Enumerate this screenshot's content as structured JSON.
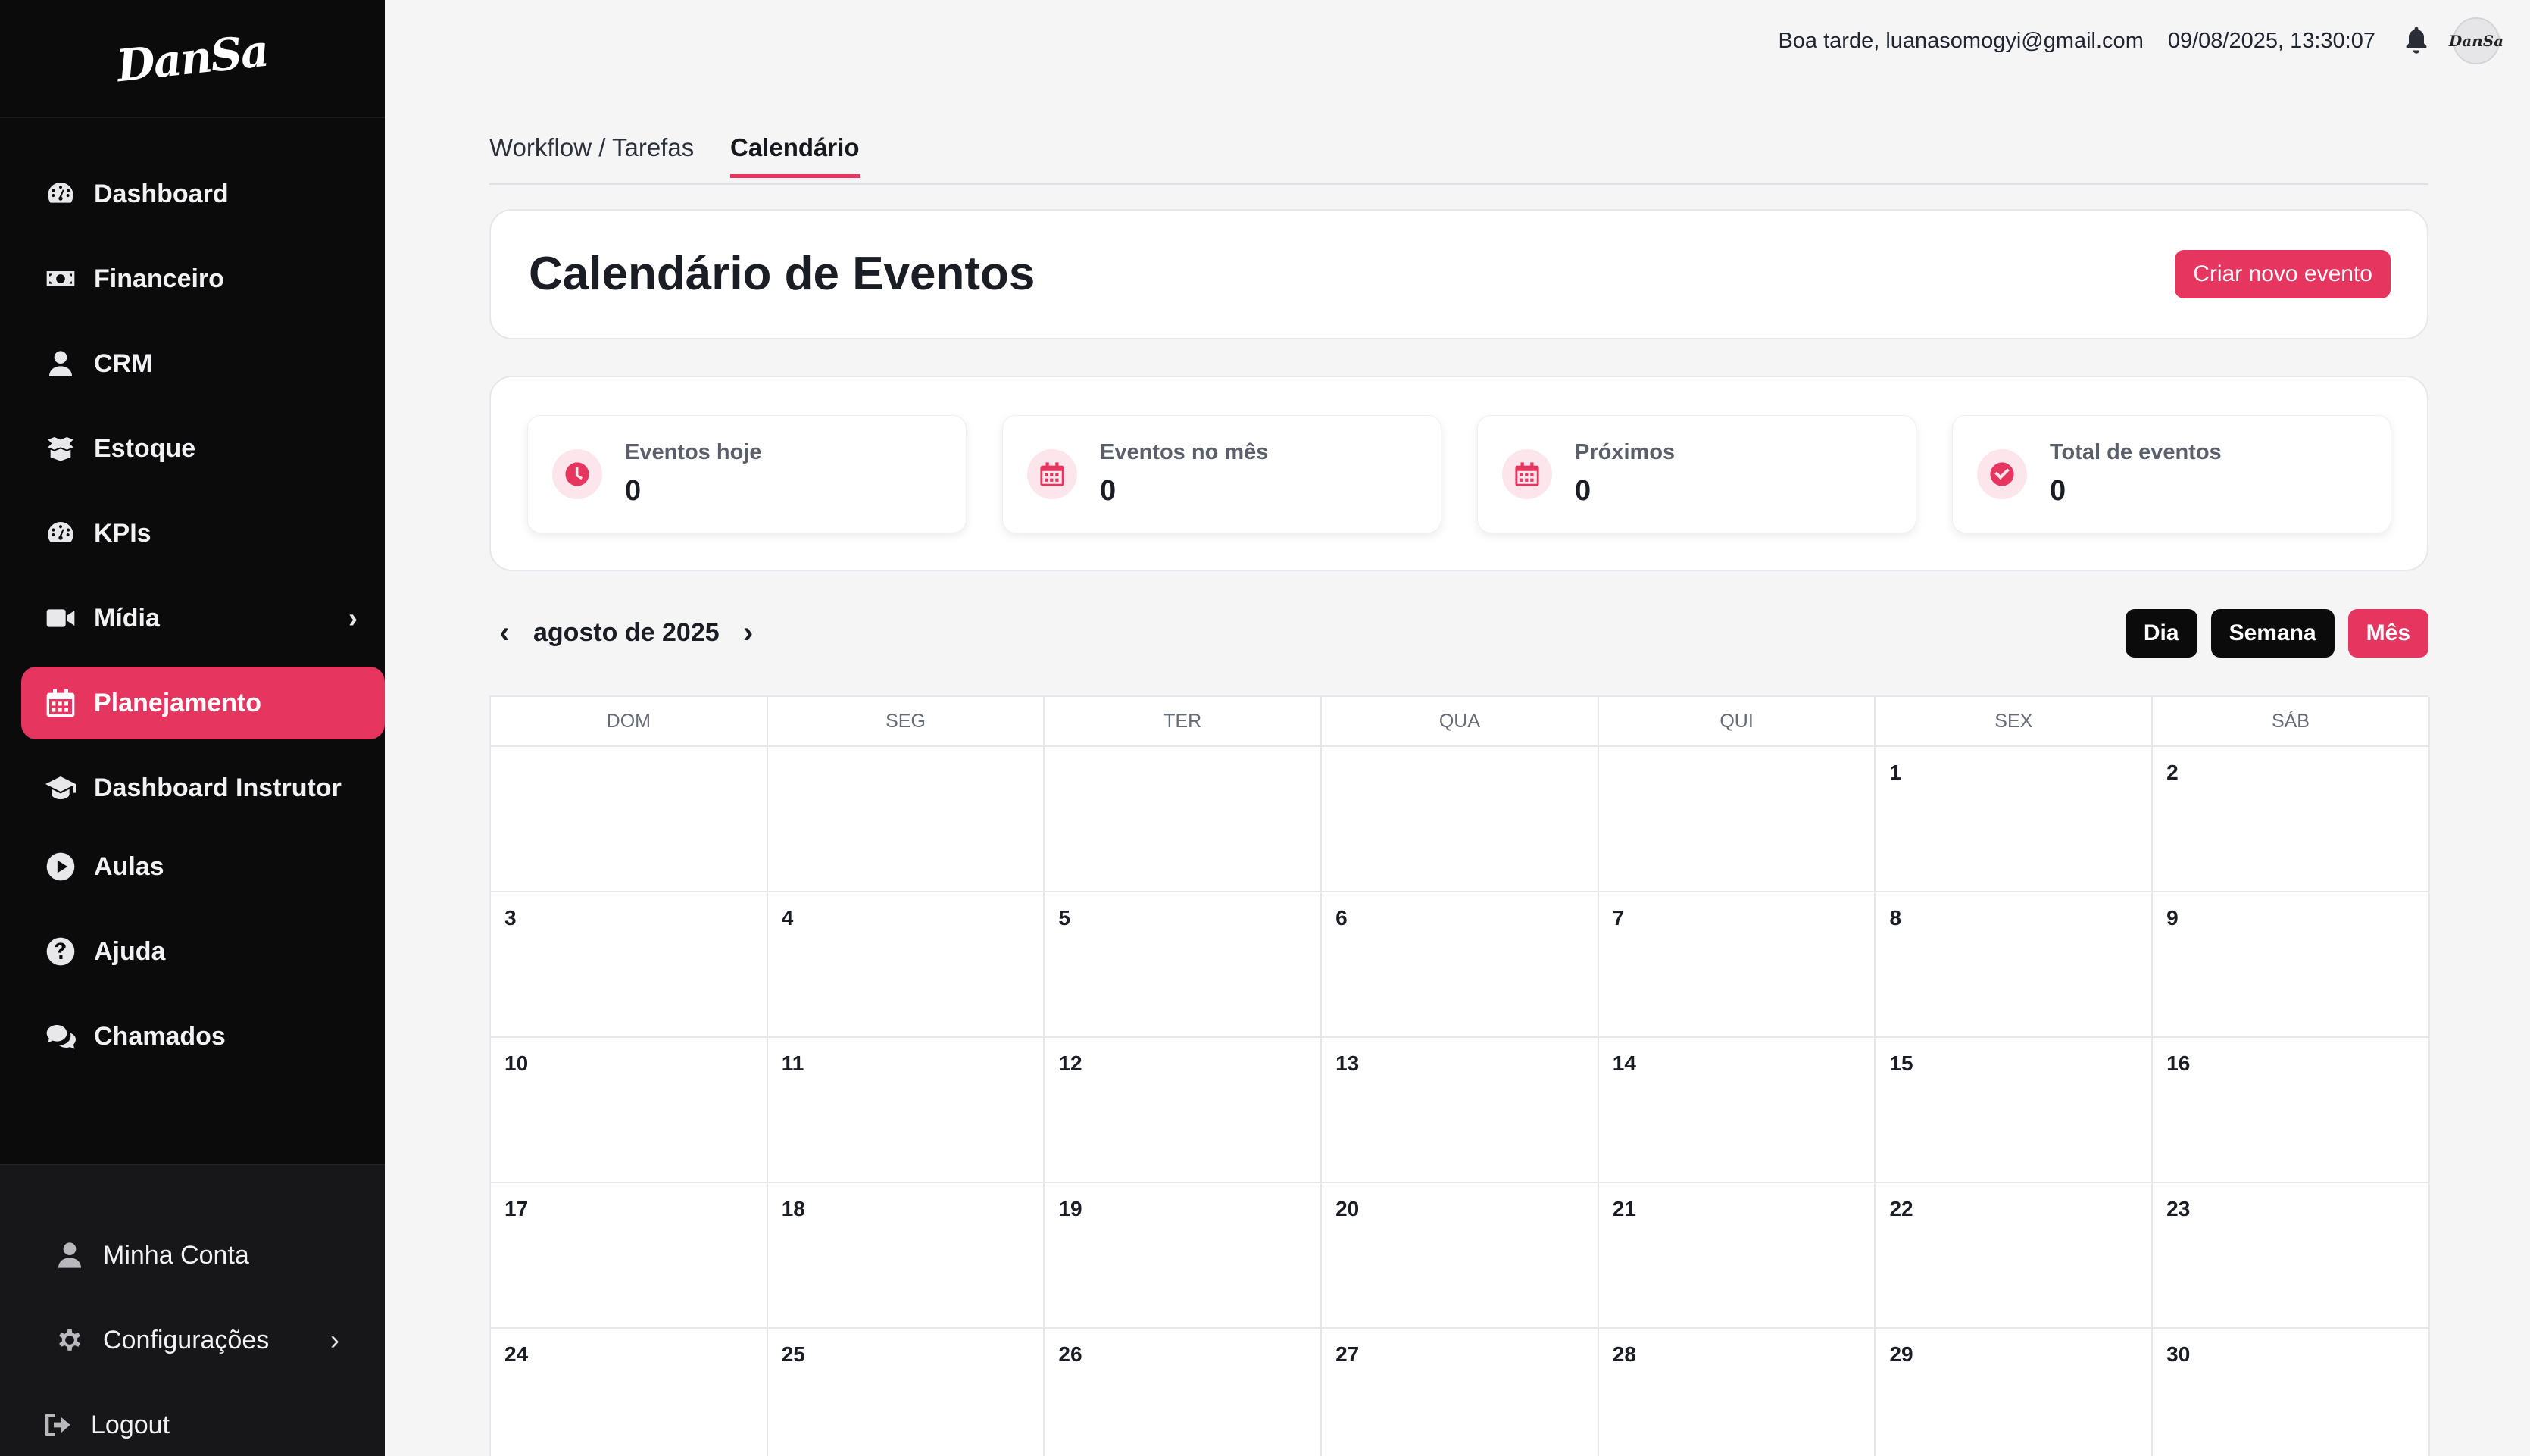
{
  "sidebar": {
    "logo": "DanSa",
    "items": [
      {
        "label": "Dashboard",
        "icon": "gauge-icon"
      },
      {
        "label": "Financeiro",
        "icon": "money-icon"
      },
      {
        "label": "CRM",
        "icon": "user-icon"
      },
      {
        "label": "Estoque",
        "icon": "box-icon"
      },
      {
        "label": "KPIs",
        "icon": "gauge-icon"
      },
      {
        "label": "Mídia",
        "icon": "video-icon"
      },
      {
        "label": "Planejamento",
        "icon": "calendar-icon",
        "active": true
      },
      {
        "label": "Dashboard Instrutor",
        "icon": "graduation-cap-icon"
      },
      {
        "label": "Aulas",
        "icon": "play-circle-icon"
      },
      {
        "label": "Ajuda",
        "icon": "question-circle-icon"
      },
      {
        "label": "Chamados",
        "icon": "comments-icon"
      }
    ],
    "bottom": [
      {
        "label": "Minha Conta",
        "icon": "user-icon"
      },
      {
        "label": "Configurações",
        "icon": "gear-icon"
      },
      {
        "label": "Logout",
        "icon": "logout-icon"
      }
    ]
  },
  "topbar": {
    "greeting": "Boa tarde, luanasomogyi@gmail.com",
    "datetime": "09/08/2025, 13:30:07",
    "avatar_text": "DanSa"
  },
  "tabs": [
    {
      "label": "Workflow / Tarefas"
    },
    {
      "label": "Calendário",
      "active": true
    }
  ],
  "header": {
    "title": "Calendário de Eventos",
    "new_event_button": "Criar novo evento"
  },
  "stats": [
    {
      "label": "Eventos hoje",
      "value": "0",
      "icon": "clock-icon"
    },
    {
      "label": "Eventos no mês",
      "value": "0",
      "icon": "calendar-icon"
    },
    {
      "label": "Próximos",
      "value": "0",
      "icon": "calendar-icon"
    },
    {
      "label": "Total de eventos",
      "value": "0",
      "icon": "check-circle-icon"
    }
  ],
  "calendar": {
    "month_label": "agosto de 2025",
    "views": [
      "Dia",
      "Semana",
      "Mês"
    ],
    "active_view": "Mês",
    "weekdays": [
      "DOM",
      "SEG",
      "TER",
      "QUA",
      "QUI",
      "SEX",
      "SÁB"
    ],
    "weeks": [
      [
        "",
        "",
        "",
        "",
        "",
        "1",
        "2"
      ],
      [
        "3",
        "4",
        "5",
        "6",
        "7",
        "8",
        "9"
      ],
      [
        "10",
        "11",
        "12",
        "13",
        "14",
        "15",
        "16"
      ],
      [
        "17",
        "18",
        "19",
        "20",
        "21",
        "22",
        "23"
      ],
      [
        "24",
        "25",
        "26",
        "27",
        "28",
        "29",
        "30"
      ]
    ]
  },
  "colors": {
    "accent": "#e6365f",
    "sidebar_bg": "#0b0b0c"
  }
}
